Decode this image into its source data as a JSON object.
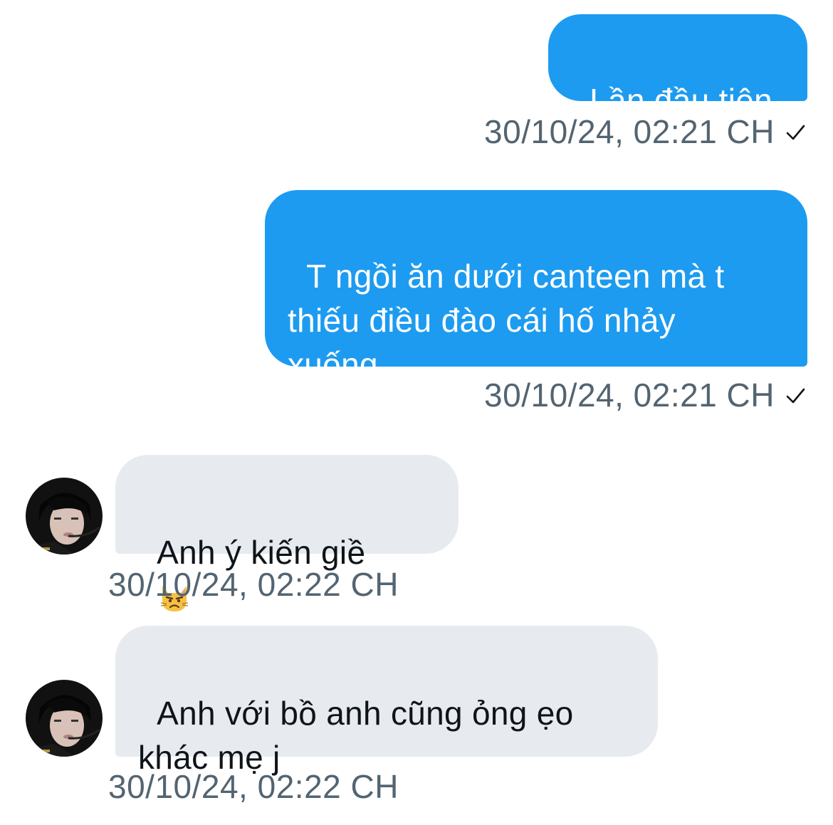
{
  "conversation": {
    "messages": [
      {
        "direction": "outgoing",
        "text": "Lần đầu tiên",
        "timestamp": "30/10/24, 02:21 CH",
        "status_icon": "checkmark-icon"
      },
      {
        "direction": "outgoing",
        "text": "T ngồi ăn dưới canteen mà t\nthiếu điều đào cái hố nhảy\nxuống",
        "timestamp": "30/10/24, 02:21 CH",
        "status_icon": "checkmark-icon"
      },
      {
        "direction": "incoming",
        "text": "Anh ý kiến giề",
        "emoji": "pouting-cat-emoji",
        "timestamp": "30/10/24, 02:22 CH",
        "avatar": "avatar-icon"
      },
      {
        "direction": "incoming",
        "text": "Anh với bồ anh cũng ỏng ẹo\nkhác mẹ j",
        "timestamp": "30/10/24, 02:22 CH",
        "avatar": "avatar-icon"
      }
    ]
  },
  "colors": {
    "outgoing_bubble": "#1d9bf0",
    "incoming_bubble": "#e7ebef",
    "timestamp_text": "#536471",
    "incoming_text": "#0f1419"
  }
}
